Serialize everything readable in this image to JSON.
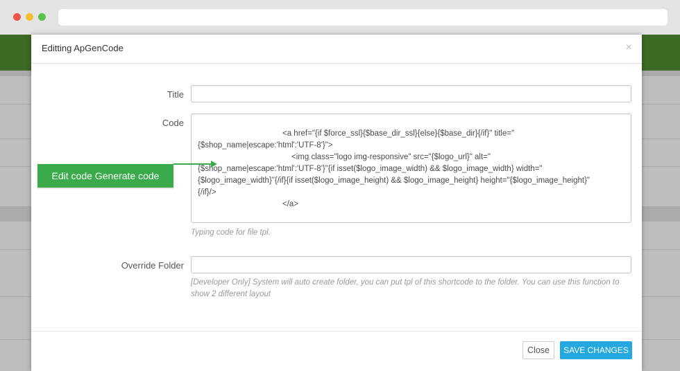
{
  "modal": {
    "title": "Editting ApGenCode",
    "close_icon": "×"
  },
  "form": {
    "title_label": "Title",
    "title_value": "",
    "code_label": "Code",
    "code_lines": [
      "<a href=\"{if $force_ssl}{$base_dir_ssl}{else}{$base_dir}{/if}\" title=\"",
      "{$shop_name|escape:'html':'UTF-8'}\">",
      "<img class=\"logo img-responsive\" src=\"{$logo_url}\" alt=\"",
      "{$shop_name|escape:'html':'UTF-8'}\"{if isset($logo_image_width) && $logo_image_width} width=\"",
      "{$logo_image_width}\"{/if}{if isset($logo_image_height) && $logo_image_height} height=\"{$logo_image_height}\"",
      "{/if}/>",
      "</a>"
    ],
    "code_help": "Typing code for file tpl.",
    "override_label": "Override Folder",
    "override_value": "",
    "override_help": "[Developer Only] System will auto create folder, you can put tpl of this shortcode to the folder. You can use this function to show 2 different layout"
  },
  "footer": {
    "close_label": "Close",
    "save_label": "SAVE CHANGES"
  },
  "callout": {
    "label": "Edit code Generate code"
  },
  "colors": {
    "accent_blue": "#25a8e0",
    "callout_green": "#3aaa4b",
    "header_green": "#3e6a25"
  }
}
